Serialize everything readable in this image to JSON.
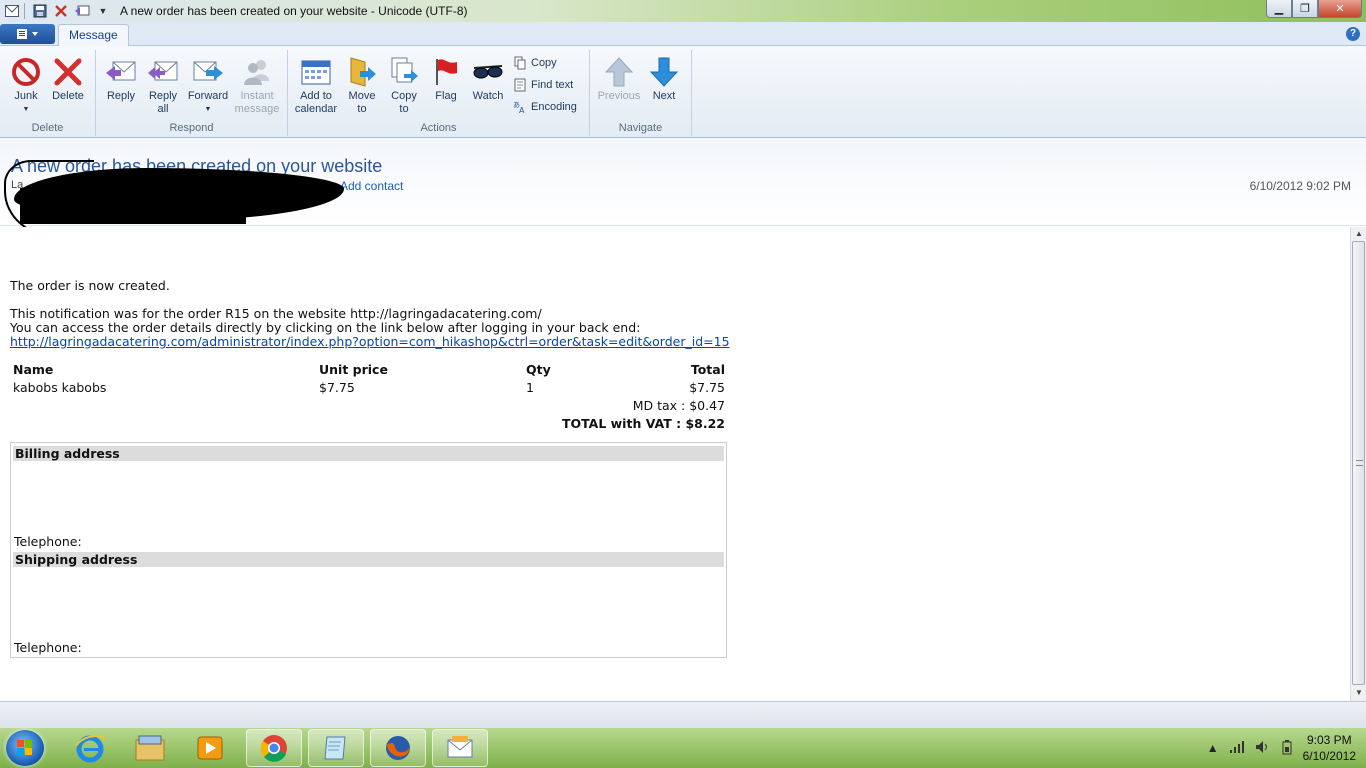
{
  "window": {
    "title": "A new order has been created on your website - Unicode (UTF-8)",
    "min_glyph": "▁",
    "max_glyph": "❐",
    "close_glyph": "✕"
  },
  "tabs": {
    "active": "Message",
    "help": "?"
  },
  "ribbon": {
    "groups": {
      "delete": "Delete",
      "respond": "Respond",
      "actions": "Actions",
      "navigate": "Navigate"
    },
    "buttons": {
      "junk": "Junk",
      "delete": "Delete",
      "reply": "Reply",
      "reply_all_1": "Reply",
      "reply_all_2": "all",
      "forward": "Forward",
      "instant_1": "Instant",
      "instant_2": "message",
      "calendar_1": "Add to",
      "calendar_2": "calendar",
      "move_1": "Move",
      "move_2": "to",
      "copyto_1": "Copy",
      "copyto_2": "to",
      "flag": "Flag",
      "watch": "Watch",
      "copy": "Copy",
      "find_text": "Find text",
      "encoding": "Encoding",
      "previous": "Previous",
      "next": "Next"
    }
  },
  "message": {
    "subject": "A new order has been created on your website",
    "from_prefix": "La",
    "add_contact": "Add contact",
    "date": "6/10/2012 9:02 PM"
  },
  "body": {
    "line1": "The order is now created.",
    "line2": "This notification was for the order R15 on the website http://lagringadacatering.com/",
    "line3": "You can access the order details directly by clicking on the link below after logging in your back end:",
    "link": "http://lagringadacatering.com/administrator/index.php?option=com_hikashop&ctrl=order&task=edit&order_id=15",
    "table": {
      "headers": [
        "Name",
        "Unit price",
        "Qty",
        "Total"
      ],
      "rows": [
        [
          "kabobs kabobs",
          "$7.75",
          "1",
          "$7.75"
        ]
      ],
      "tax": "MD tax : $0.47",
      "total": "TOTAL with VAT : $8.22"
    },
    "billing_title": "Billing address",
    "billing_tel": "Telephone:",
    "shipping_title": "Shipping address",
    "shipping_tel": "Telephone:"
  },
  "taskbar": {
    "time": "9:03 PM",
    "date": "6/10/2012"
  }
}
